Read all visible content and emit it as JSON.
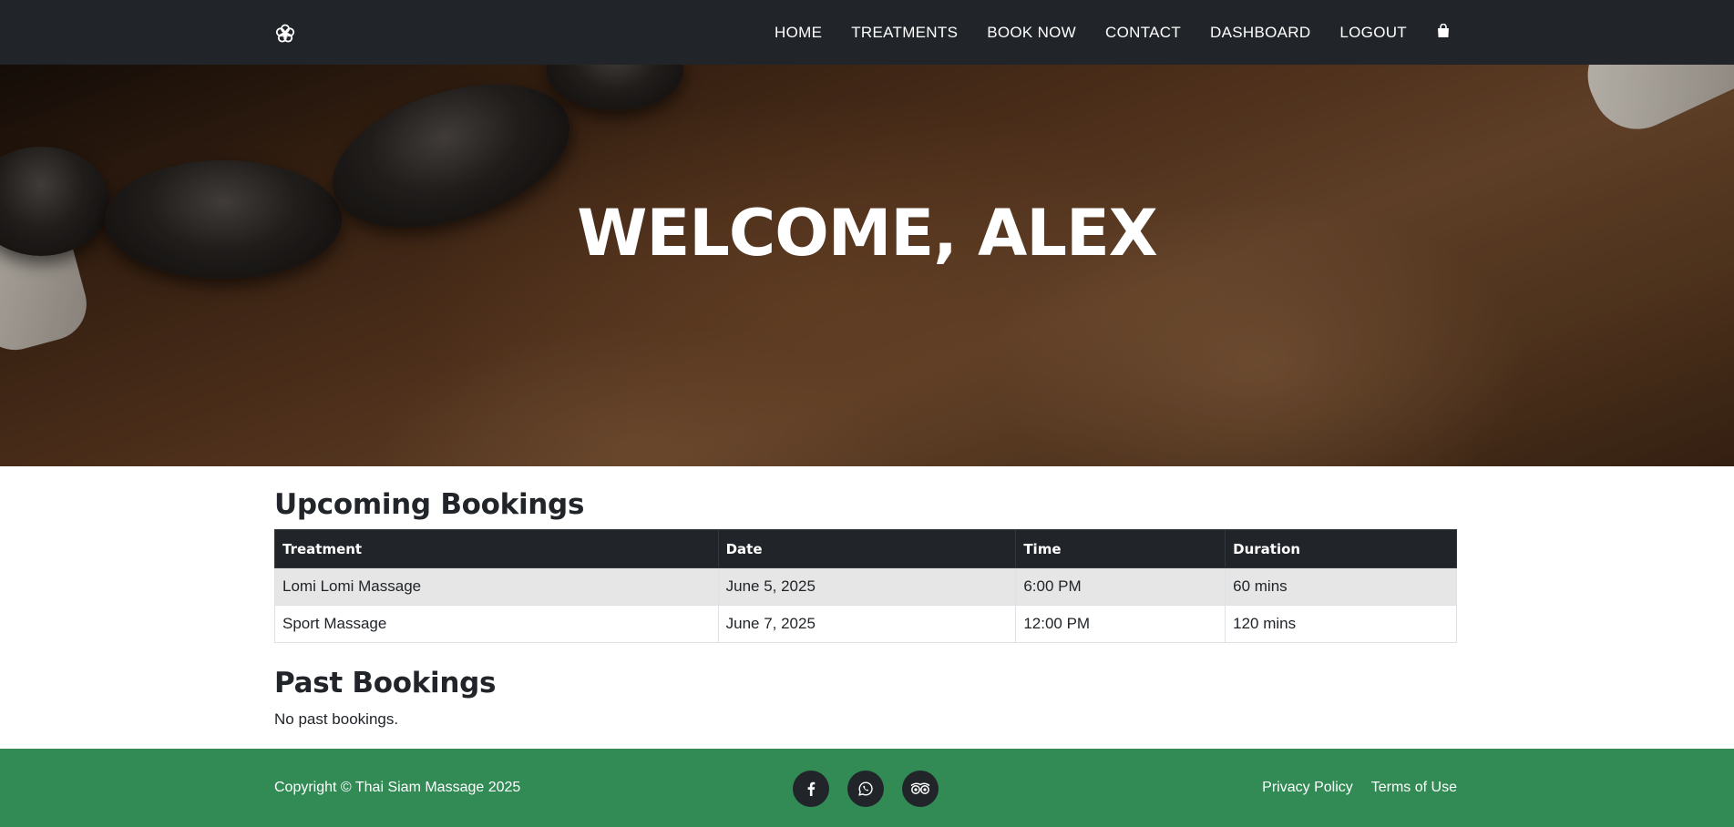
{
  "nav": {
    "logo_icon": "flower-logo-icon",
    "items": [
      {
        "label": "HOME"
      },
      {
        "label": "TREATMENTS"
      },
      {
        "label": "BOOK NOW"
      },
      {
        "label": "CONTACT"
      },
      {
        "label": "DASHBOARD"
      },
      {
        "label": "LOGOUT"
      }
    ],
    "cart_icon": "shopping-bag-icon"
  },
  "hero": {
    "title": "WELCOME, ALEX"
  },
  "upcoming": {
    "title": "Upcoming Bookings",
    "columns": [
      "Treatment",
      "Date",
      "Time",
      "Duration"
    ],
    "rows": [
      [
        "Lomi Lomi Massage",
        "June 5, 2025",
        "6:00 PM",
        "60 mins"
      ],
      [
        "Sport Massage",
        "June 7, 2025",
        "12:00 PM",
        "120 mins"
      ]
    ]
  },
  "past": {
    "title": "Past Bookings",
    "empty_message": "No past bookings."
  },
  "footer": {
    "copyright": "Copyright © Thai Siam Massage 2025",
    "social": [
      {
        "icon": "facebook-icon"
      },
      {
        "icon": "whatsapp-icon"
      },
      {
        "icon": "tripadvisor-icon"
      }
    ],
    "links": [
      {
        "label": "Privacy Policy"
      },
      {
        "label": "Terms of Use"
      }
    ]
  },
  "colors": {
    "navbar_bg": "#212529",
    "footer_bg": "#328a55",
    "table_header_bg": "#212529",
    "table_stripe": "#e6e6e6"
  }
}
